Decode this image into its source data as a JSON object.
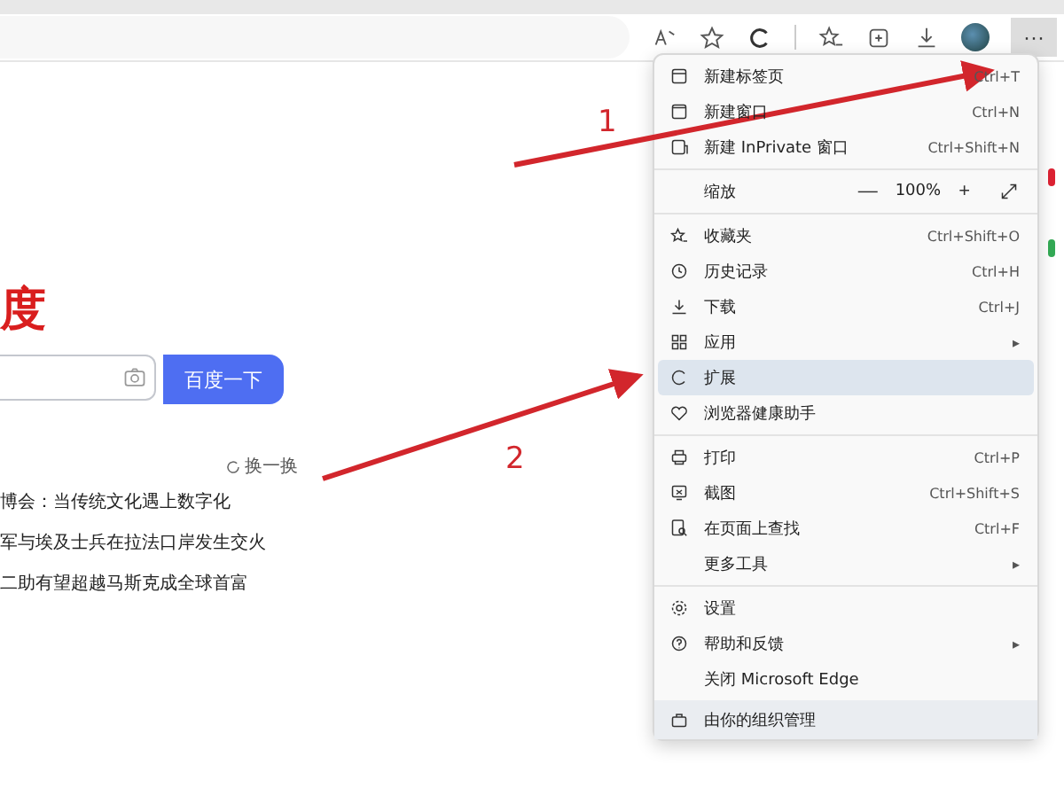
{
  "toolbar": {
    "menu_button": {
      "label": "···",
      "selected": true
    }
  },
  "page": {
    "logo": "度",
    "search": {
      "button": "百度一下"
    },
    "refresh": "换一换",
    "hot_list": [
      "博会：当传统文化遇上数字化",
      "军与埃及士兵在拉法口岸发生交火",
      "二助有望超越马斯克成全球首富"
    ]
  },
  "menu": {
    "items": [
      {
        "kind": "item",
        "label": "新建标签页",
        "shortcut": "Ctrl+T",
        "highlighted": false
      },
      {
        "kind": "item",
        "label": "新建窗口",
        "shortcut": "Ctrl+N",
        "highlighted": false
      },
      {
        "kind": "item",
        "label": "新建 InPrivate 窗口",
        "shortcut": "Ctrl+Shift+N",
        "highlighted": false
      },
      {
        "kind": "separator"
      },
      {
        "kind": "zoom",
        "label": "缩放",
        "minus": "—",
        "value": "100%",
        "plus": "+"
      },
      {
        "kind": "separator"
      },
      {
        "kind": "item",
        "label": "收藏夹",
        "shortcut": "Ctrl+Shift+O",
        "highlighted": false
      },
      {
        "kind": "item",
        "label": "历史记录",
        "shortcut": "Ctrl+H",
        "highlighted": false
      },
      {
        "kind": "item",
        "label": "下载",
        "shortcut": "Ctrl+J",
        "highlighted": false
      },
      {
        "kind": "item",
        "label": "应用",
        "arrow": "▸",
        "highlighted": false
      },
      {
        "kind": "item",
        "label": "扩展",
        "highlighted": true
      },
      {
        "kind": "item",
        "label": "浏览器健康助手",
        "highlighted": false
      },
      {
        "kind": "separator"
      },
      {
        "kind": "item",
        "label": "打印",
        "shortcut": "Ctrl+P",
        "highlighted": false
      },
      {
        "kind": "item",
        "label": "截图",
        "shortcut": "Ctrl+Shift+S",
        "highlighted": false
      },
      {
        "kind": "item",
        "label": "在页面上查找",
        "shortcut": "Ctrl+F",
        "highlighted": false
      },
      {
        "kind": "item",
        "label": "更多工具",
        "arrow": "▸",
        "highlighted": false
      },
      {
        "kind": "separator"
      },
      {
        "kind": "item",
        "label": "设置",
        "highlighted": false
      },
      {
        "kind": "item",
        "label": "帮助和反馈",
        "arrow": "▸",
        "highlighted": false
      },
      {
        "kind": "item",
        "label": "关闭 Microsoft Edge",
        "highlighted": false
      },
      {
        "kind": "footer",
        "label": "由你的组织管理"
      }
    ]
  },
  "annotations": [
    {
      "label": "1"
    },
    {
      "label": "2"
    }
  ]
}
